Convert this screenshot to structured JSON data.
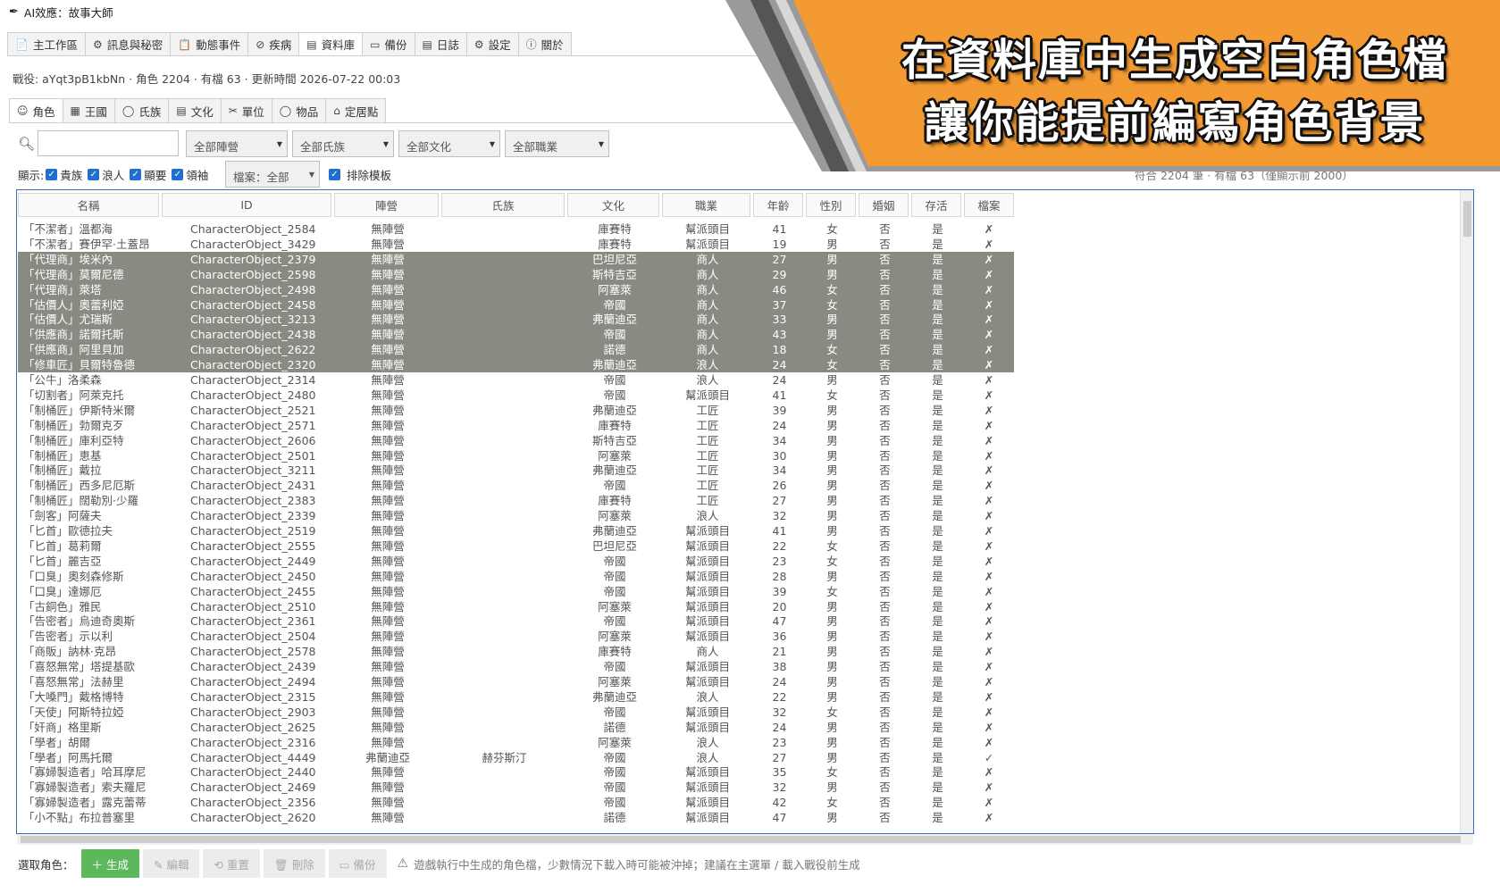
{
  "window": {
    "title": "AI效應：故事大師"
  },
  "main_tabs": [
    {
      "icon": "📄",
      "label": "主工作區"
    },
    {
      "icon": "⚙",
      "label": "訊息與秘密"
    },
    {
      "icon": "📋",
      "label": "動態事件"
    },
    {
      "icon": "⊘",
      "label": "疾病"
    },
    {
      "icon": "▤",
      "label": "資料庫"
    },
    {
      "icon": "▭",
      "label": "備份"
    },
    {
      "icon": "▤",
      "label": "日誌"
    },
    {
      "icon": "⚙",
      "label": "設定"
    },
    {
      "icon": "ⓘ",
      "label": "關於"
    }
  ],
  "info_line": "戰役: aYqt3pB1kbNn · 角色 2204 · 有檔 63 · 更新時間 2026-07-22 00:03",
  "sub_tabs": [
    {
      "icon": "☺",
      "label": "角色"
    },
    {
      "icon": "▦",
      "label": "王國"
    },
    {
      "icon": "◯",
      "label": "氏族"
    },
    {
      "icon": "▤",
      "label": "文化"
    },
    {
      "icon": "✂",
      "label": "單位"
    },
    {
      "icon": "◯",
      "label": "物品"
    },
    {
      "icon": "⌂",
      "label": "定居點"
    }
  ],
  "filters": {
    "search_value": "",
    "camp": "全部陣營",
    "clan": "全部氏族",
    "culture": "全部文化",
    "profession": "全部職業"
  },
  "display": {
    "label": "顯示:",
    "noble": "貴族",
    "wanderer": "浪人",
    "notable": "顯要",
    "leader": "領袖",
    "file_filter": "檔案：全部",
    "exclude_templates": "排除模板",
    "count_text": "符合 2204 筆 · 有檔 63（僅顯示前 2000）"
  },
  "table": {
    "columns": [
      "名稱",
      "ID",
      "陣營",
      "氏族",
      "文化",
      "職業",
      "年齡",
      "性別",
      "婚姻",
      "存活",
      "檔案"
    ],
    "rows": [
      [
        "「不潔者」溫都海",
        "CharacterObject_2584",
        "無陣營",
        "",
        "庫賽特",
        "幫派頭目",
        "41",
        "女",
        "否",
        "是",
        "✗"
      ],
      [
        "「不潔者」賽伊罕·土蓋昂",
        "CharacterObject_3429",
        "無陣營",
        "",
        "庫賽特",
        "幫派頭目",
        "19",
        "男",
        "否",
        "是",
        "✗"
      ],
      [
        "「代理商」埃米內",
        "CharacterObject_2379",
        "無陣營",
        "",
        "巴坦尼亞",
        "商人",
        "27",
        "男",
        "否",
        "是",
        "✗"
      ],
      [
        "「代理商」莫爾尼德",
        "CharacterObject_2598",
        "無陣營",
        "",
        "斯特吉亞",
        "商人",
        "29",
        "男",
        "否",
        "是",
        "✗"
      ],
      [
        "「代理商」萊塔",
        "CharacterObject_2498",
        "無陣營",
        "",
        "阿塞萊",
        "商人",
        "46",
        "女",
        "否",
        "是",
        "✗"
      ],
      [
        "「估價人」奧蕾利婭",
        "CharacterObject_2458",
        "無陣營",
        "",
        "帝國",
        "商人",
        "37",
        "女",
        "否",
        "是",
        "✗"
      ],
      [
        "「估價人」尤瑞斯",
        "CharacterObject_3213",
        "無陣營",
        "",
        "弗蘭迪亞",
        "商人",
        "33",
        "男",
        "否",
        "是",
        "✗"
      ],
      [
        "「供應商」諾爾托斯",
        "CharacterObject_2438",
        "無陣營",
        "",
        "帝國",
        "商人",
        "43",
        "男",
        "否",
        "是",
        "✗"
      ],
      [
        "「供應商」阿里貝加",
        "CharacterObject_2622",
        "無陣營",
        "",
        "諾德",
        "商人",
        "18",
        "女",
        "否",
        "是",
        "✗"
      ],
      [
        "「修車匠」貝爾特魯德",
        "CharacterObject_2320",
        "無陣營",
        "",
        "弗蘭迪亞",
        "浪人",
        "24",
        "女",
        "否",
        "是",
        "✗"
      ],
      [
        "「公牛」洛柔森",
        "CharacterObject_2314",
        "無陣營",
        "",
        "帝國",
        "浪人",
        "24",
        "男",
        "否",
        "是",
        "✗"
      ],
      [
        "「切割者」阿萊克托",
        "CharacterObject_2480",
        "無陣營",
        "",
        "帝國",
        "幫派頭目",
        "41",
        "女",
        "否",
        "是",
        "✗"
      ],
      [
        "「制桶匠」伊斯特米爾",
        "CharacterObject_2521",
        "無陣營",
        "",
        "弗蘭迪亞",
        "工匠",
        "39",
        "男",
        "否",
        "是",
        "✗"
      ],
      [
        "「制桶匠」勃爾克歹",
        "CharacterObject_2571",
        "無陣營",
        "",
        "庫賽特",
        "工匠",
        "24",
        "男",
        "否",
        "是",
        "✗"
      ],
      [
        "「制桶匠」庫利亞特",
        "CharacterObject_2606",
        "無陣營",
        "",
        "斯特吉亞",
        "工匠",
        "34",
        "男",
        "否",
        "是",
        "✗"
      ],
      [
        "「制桶匠」恵基",
        "CharacterObject_2501",
        "無陣營",
        "",
        "阿塞萊",
        "工匠",
        "30",
        "男",
        "否",
        "是",
        "✗"
      ],
      [
        "「制桶匠」戴拉",
        "CharacterObject_3211",
        "無陣營",
        "",
        "弗蘭迪亞",
        "工匠",
        "34",
        "男",
        "否",
        "是",
        "✗"
      ],
      [
        "「制桶匠」西多尼厄斯",
        "CharacterObject_2431",
        "無陣營",
        "",
        "帝國",
        "工匠",
        "26",
        "男",
        "否",
        "是",
        "✗"
      ],
      [
        "「制桶匠」闊勒別·少羅",
        "CharacterObject_2383",
        "無陣營",
        "",
        "庫賽特",
        "工匠",
        "27",
        "男",
        "否",
        "是",
        "✗"
      ],
      [
        "「劍客」阿薩夫",
        "CharacterObject_2339",
        "無陣營",
        "",
        "阿塞萊",
        "浪人",
        "32",
        "男",
        "否",
        "是",
        "✗"
      ],
      [
        "「匕首」歐德拉夫",
        "CharacterObject_2519",
        "無陣營",
        "",
        "弗蘭迪亞",
        "幫派頭目",
        "41",
        "男",
        "否",
        "是",
        "✗"
      ],
      [
        "「匕首」葛莉爾",
        "CharacterObject_2555",
        "無陣營",
        "",
        "巴坦尼亞",
        "幫派頭目",
        "22",
        "女",
        "否",
        "是",
        "✗"
      ],
      [
        "「匕首」麗吉亞",
        "CharacterObject_2449",
        "無陣營",
        "",
        "帝國",
        "幫派頭目",
        "23",
        "女",
        "否",
        "是",
        "✗"
      ],
      [
        "「口臭」奧刻森修斯",
        "CharacterObject_2450",
        "無陣營",
        "",
        "帝國",
        "幫派頭目",
        "28",
        "男",
        "否",
        "是",
        "✗"
      ],
      [
        "「口臭」達娜厄",
        "CharacterObject_2455",
        "無陣營",
        "",
        "帝國",
        "幫派頭目",
        "39",
        "女",
        "否",
        "是",
        "✗"
      ],
      [
        "「古銅色」雅民",
        "CharacterObject_2510",
        "無陣營",
        "",
        "阿塞萊",
        "幫派頭目",
        "20",
        "男",
        "否",
        "是",
        "✗"
      ],
      [
        "「告密者」烏迪奇奧斯",
        "CharacterObject_2361",
        "無陣營",
        "",
        "帝國",
        "幫派頭目",
        "47",
        "男",
        "否",
        "是",
        "✗"
      ],
      [
        "「告密者」示以利",
        "CharacterObject_2504",
        "無陣營",
        "",
        "阿塞萊",
        "幫派頭目",
        "36",
        "男",
        "否",
        "是",
        "✗"
      ],
      [
        "「商販」訥林·克昂",
        "CharacterObject_2578",
        "無陣營",
        "",
        "庫賽特",
        "商人",
        "21",
        "男",
        "否",
        "是",
        "✗"
      ],
      [
        "「喜怒無常」塔提基歐",
        "CharacterObject_2439",
        "無陣營",
        "",
        "帝國",
        "幫派頭目",
        "38",
        "男",
        "否",
        "是",
        "✗"
      ],
      [
        "「喜怒無常」法赫里",
        "CharacterObject_2494",
        "無陣營",
        "",
        "阿塞萊",
        "幫派頭目",
        "24",
        "男",
        "否",
        "是",
        "✗"
      ],
      [
        "「大嗓門」戴格博特",
        "CharacterObject_2315",
        "無陣營",
        "",
        "弗蘭迪亞",
        "浪人",
        "22",
        "男",
        "否",
        "是",
        "✗"
      ],
      [
        "「天使」阿斯特拉婭",
        "CharacterObject_2903",
        "無陣營",
        "",
        "帝國",
        "幫派頭目",
        "32",
        "女",
        "否",
        "是",
        "✗"
      ],
      [
        "「奸商」格里斯",
        "CharacterObject_2625",
        "無陣營",
        "",
        "諾德",
        "幫派頭目",
        "24",
        "男",
        "否",
        "是",
        "✗"
      ],
      [
        "「學者」胡爾",
        "CharacterObject_2316",
        "無陣營",
        "",
        "阿塞萊",
        "浪人",
        "23",
        "男",
        "否",
        "是",
        "✗"
      ],
      [
        "「學者」阿馬托爾",
        "CharacterObject_4449",
        "弗蘭迪亞",
        "赫芬斯汀",
        "帝國",
        "浪人",
        "27",
        "男",
        "否",
        "是",
        "✓"
      ],
      [
        "「寡婦製造者」哈耳摩尼",
        "CharacterObject_2440",
        "無陣營",
        "",
        "帝國",
        "幫派頭目",
        "35",
        "女",
        "否",
        "是",
        "✗"
      ],
      [
        "「寡婦製造者」索夫羅尼",
        "CharacterObject_2469",
        "無陣營",
        "",
        "帝國",
        "幫派頭目",
        "32",
        "男",
        "否",
        "是",
        "✗"
      ],
      [
        "「寡婦製造者」露克蕾蒂",
        "CharacterObject_2356",
        "無陣營",
        "",
        "帝國",
        "幫派頭目",
        "42",
        "女",
        "否",
        "是",
        "✗"
      ],
      [
        "「小不點」布拉普塞里",
        "CharacterObject_2620",
        "無陣營",
        "",
        "諾德",
        "幫派頭目",
        "47",
        "男",
        "否",
        "是",
        "✗"
      ]
    ],
    "selected_rows": [
      2,
      3,
      4,
      5,
      6,
      7,
      8,
      9
    ]
  },
  "bottom": {
    "label": "選取角色：",
    "generate": "＋ 生成",
    "edit": "✎ 編輯",
    "reset": "⟲ 重置",
    "delete": "🗑 刪除",
    "backup": "▭ 備份",
    "warning": "遊戲執行中生成的角色檔，少數情況下載入時可能被沖掉；建議在主選單 / 載入戰役前生成"
  },
  "banner": {
    "line1": "在資料庫中生成空白角色檔",
    "line2": "讓你能提前編寫角色背景",
    "color": "#F49A32"
  }
}
